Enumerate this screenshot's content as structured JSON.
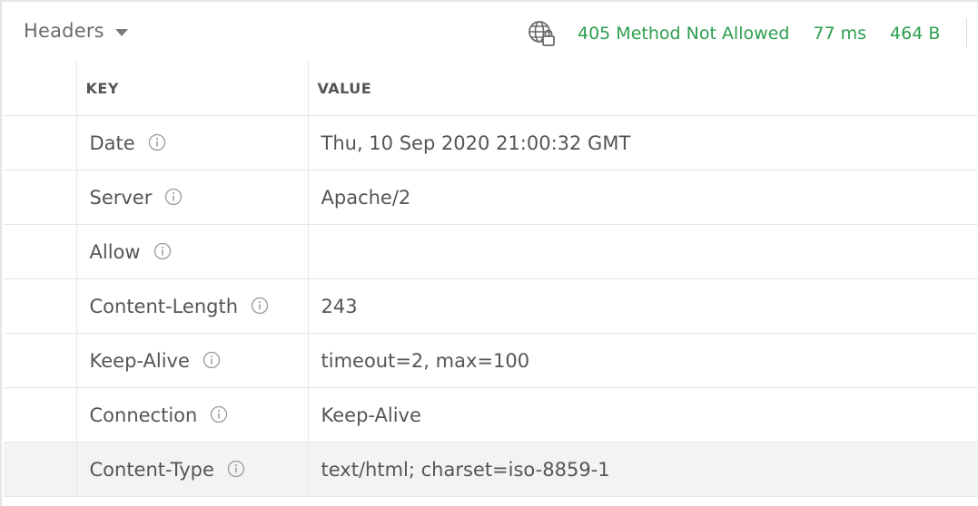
{
  "topbar": {
    "section_label": "Headers",
    "status": "405 Method Not Allowed",
    "time": "77 ms",
    "size": "464 B"
  },
  "table": {
    "columns": [
      "KEY",
      "VALUE"
    ],
    "rows": [
      {
        "key": "Date",
        "value": "Thu, 10 Sep 2020 21:00:32 GMT"
      },
      {
        "key": "Server",
        "value": "Apache/2"
      },
      {
        "key": "Allow",
        "value": ""
      },
      {
        "key": "Content-Length",
        "value": "243"
      },
      {
        "key": "Keep-Alive",
        "value": "timeout=2, max=100"
      },
      {
        "key": "Connection",
        "value": "Keep-Alive"
      },
      {
        "key": "Content-Type",
        "value": "text/html; charset=iso-8859-1"
      }
    ]
  },
  "icons": {
    "status_globe": "globe-lock-icon",
    "row_info": "info-icon",
    "dropdown": "chevron-down-icon"
  },
  "colors": {
    "status_green": "#2d9f4f",
    "row_highlight": "#f3f3f3",
    "border": "#e6e6e6"
  }
}
